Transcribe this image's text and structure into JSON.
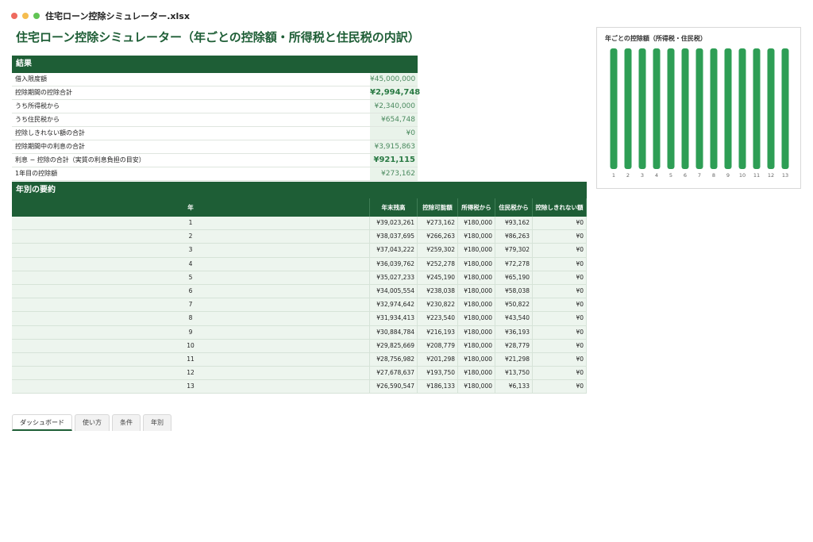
{
  "window": {
    "title": "住宅ローン控除シミュレーター.xlsx"
  },
  "sheet_title": "住宅ローン控除シミュレーター（年ごとの控除額・所得税と住民税の内訳）",
  "results": {
    "header": "結果",
    "rows": [
      {
        "label": "借入限度額",
        "value": "¥45,000,000"
      },
      {
        "label": "控除期間の控除合計",
        "value": "¥2,994,748"
      },
      {
        "label": "うち所得税から",
        "value": "¥2,340,000"
      },
      {
        "label": "うち住民税から",
        "value": "¥654,748"
      },
      {
        "label": "控除しきれない額の合計",
        "value": "¥0"
      },
      {
        "label": "控除期間中の利息の合計",
        "value": "¥3,915,863"
      },
      {
        "label": "利息 − 控除の合計（実質の利息負担の目安）",
        "value": "¥921,115"
      },
      {
        "label": "1年目の控除額",
        "value": "¥273,162"
      }
    ]
  },
  "yearly": {
    "header": "年別の要約",
    "columns": {
      "year": "年",
      "balance": "年末残高",
      "deduction": "控除可能額",
      "income_tax": "所得税から",
      "resident_tax": "住民税から",
      "not_deducted": "控除しきれない額"
    },
    "rows": [
      {
        "year": "1",
        "balance": "¥39,023,261",
        "deduction": "¥273,162",
        "income_tax": "¥180,000",
        "resident_tax": "¥93,162",
        "not_deducted": "¥0"
      },
      {
        "year": "2",
        "balance": "¥38,037,695",
        "deduction": "¥266,263",
        "income_tax": "¥180,000",
        "resident_tax": "¥86,263",
        "not_deducted": "¥0"
      },
      {
        "year": "3",
        "balance": "¥37,043,222",
        "deduction": "¥259,302",
        "income_tax": "¥180,000",
        "resident_tax": "¥79,302",
        "not_deducted": "¥0"
      },
      {
        "year": "4",
        "balance": "¥36,039,762",
        "deduction": "¥252,278",
        "income_tax": "¥180,000",
        "resident_tax": "¥72,278",
        "not_deducted": "¥0"
      },
      {
        "year": "5",
        "balance": "¥35,027,233",
        "deduction": "¥245,190",
        "income_tax": "¥180,000",
        "resident_tax": "¥65,190",
        "not_deducted": "¥0"
      },
      {
        "year": "6",
        "balance": "¥34,005,554",
        "deduction": "¥238,038",
        "income_tax": "¥180,000",
        "resident_tax": "¥58,038",
        "not_deducted": "¥0"
      },
      {
        "year": "7",
        "balance": "¥32,974,642",
        "deduction": "¥230,822",
        "income_tax": "¥180,000",
        "resident_tax": "¥50,822",
        "not_deducted": "¥0"
      },
      {
        "year": "8",
        "balance": "¥31,934,413",
        "deduction": "¥223,540",
        "income_tax": "¥180,000",
        "resident_tax": "¥43,540",
        "not_deducted": "¥0"
      },
      {
        "year": "9",
        "balance": "¥30,884,784",
        "deduction": "¥216,193",
        "income_tax": "¥180,000",
        "resident_tax": "¥36,193",
        "not_deducted": "¥0"
      },
      {
        "year": "10",
        "balance": "¥29,825,669",
        "deduction": "¥208,779",
        "income_tax": "¥180,000",
        "resident_tax": "¥28,779",
        "not_deducted": "¥0"
      },
      {
        "year": "11",
        "balance": "¥28,756,982",
        "deduction": "¥201,298",
        "income_tax": "¥180,000",
        "resident_tax": "¥21,298",
        "not_deducted": "¥0"
      },
      {
        "year": "12",
        "balance": "¥27,678,637",
        "deduction": "¥193,750",
        "income_tax": "¥180,000",
        "resident_tax": "¥13,750",
        "not_deducted": "¥0"
      },
      {
        "year": "13",
        "balance": "¥26,590,547",
        "deduction": "¥186,133",
        "income_tax": "¥180,000",
        "resident_tax": "¥6,133",
        "not_deducted": "¥0"
      }
    ]
  },
  "chart_data": {
    "type": "bar",
    "title": "年ごとの控除額（所得税・住民税）",
    "categories": [
      "1",
      "2",
      "3",
      "4",
      "5",
      "6",
      "7",
      "8",
      "9",
      "10",
      "11",
      "12",
      "13"
    ],
    "series": [
      {
        "values": [
          180000,
          180000,
          180000,
          180000,
          180000,
          180000,
          180000,
          180000,
          180000,
          180000,
          180000,
          180000,
          180000
        ]
      }
    ],
    "ylim": [
      0,
      180000
    ],
    "grid": false,
    "color": "#2e9e55"
  },
  "tabs": [
    {
      "label": "ダッシュボード",
      "active": true
    },
    {
      "label": "使い方",
      "active": false
    },
    {
      "label": "条件",
      "active": false
    },
    {
      "label": "年別",
      "active": false
    }
  ]
}
